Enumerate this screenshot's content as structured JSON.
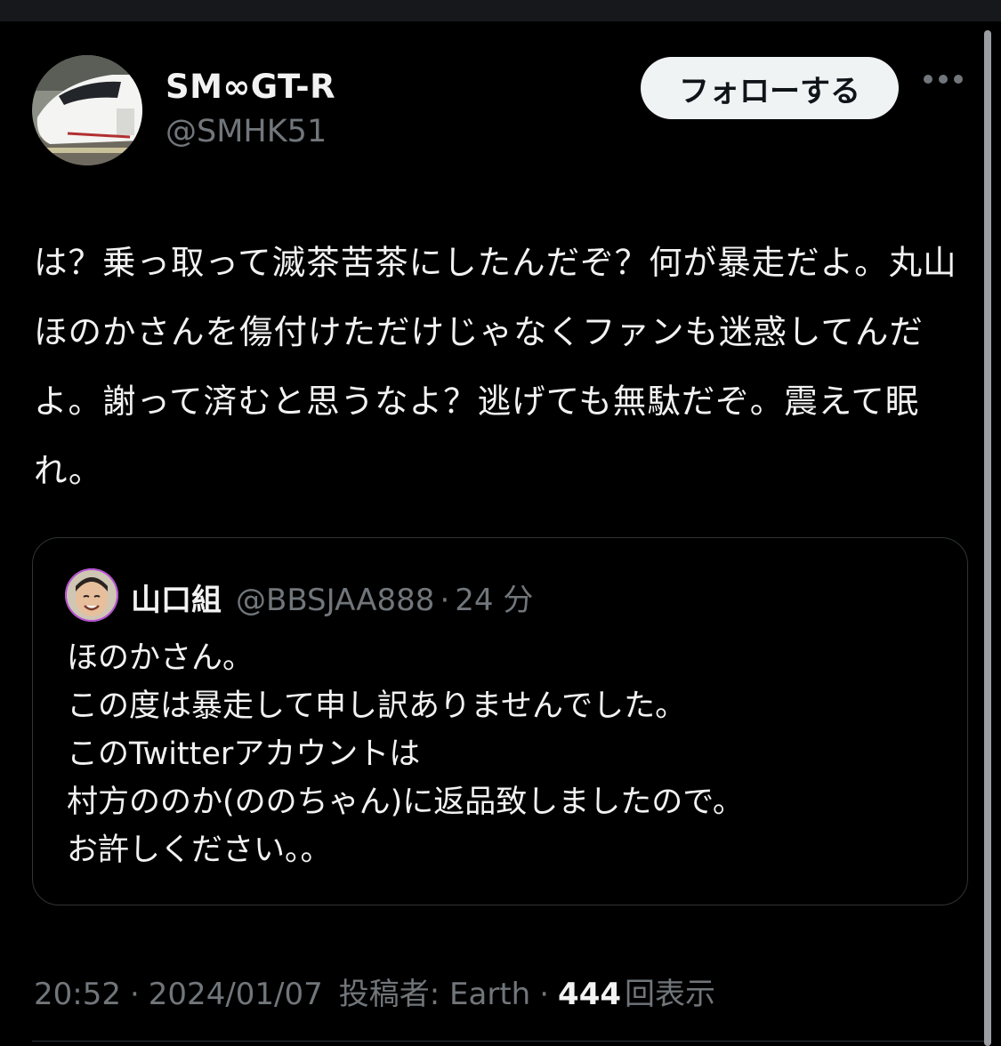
{
  "author": {
    "name": "SM∞GT-R",
    "handle": "@SMHK51",
    "avatar": "train-avatar"
  },
  "follow_label": "フォローする",
  "more_icon": "more-horizontal-icon",
  "tweet_text": "は？乗っ取って滅茶苦茶にしたんだぞ？何が暴走だよ。丸山ほのかさんを傷付けただけじゃなくファンも迷惑してんだよ。謝って済むと思うなよ？逃げても無駄だぞ。震えて眠れ。",
  "quote": {
    "name": "山口組",
    "handle": "@BBSJAA888",
    "dot": "·",
    "time": "24 分",
    "text": "ほのかさん。\nこの度は暴走して申し訳ありませんでした。\nこのTwitterアカウントは\n村方ののか(ののちゃん)に返品致しましたので。\nお許しください。。"
  },
  "meta": {
    "time": "20:52",
    "date": "2024/01/07",
    "posted_by": "投稿者: Earth",
    "views_count": "444",
    "views_label": "回表示",
    "sep": "·"
  },
  "colors": {
    "background": "#000000",
    "text": "#f2f2f2",
    "secondary": "#71767b",
    "button_bg": "#eff3f4",
    "border": "#2f3336"
  }
}
